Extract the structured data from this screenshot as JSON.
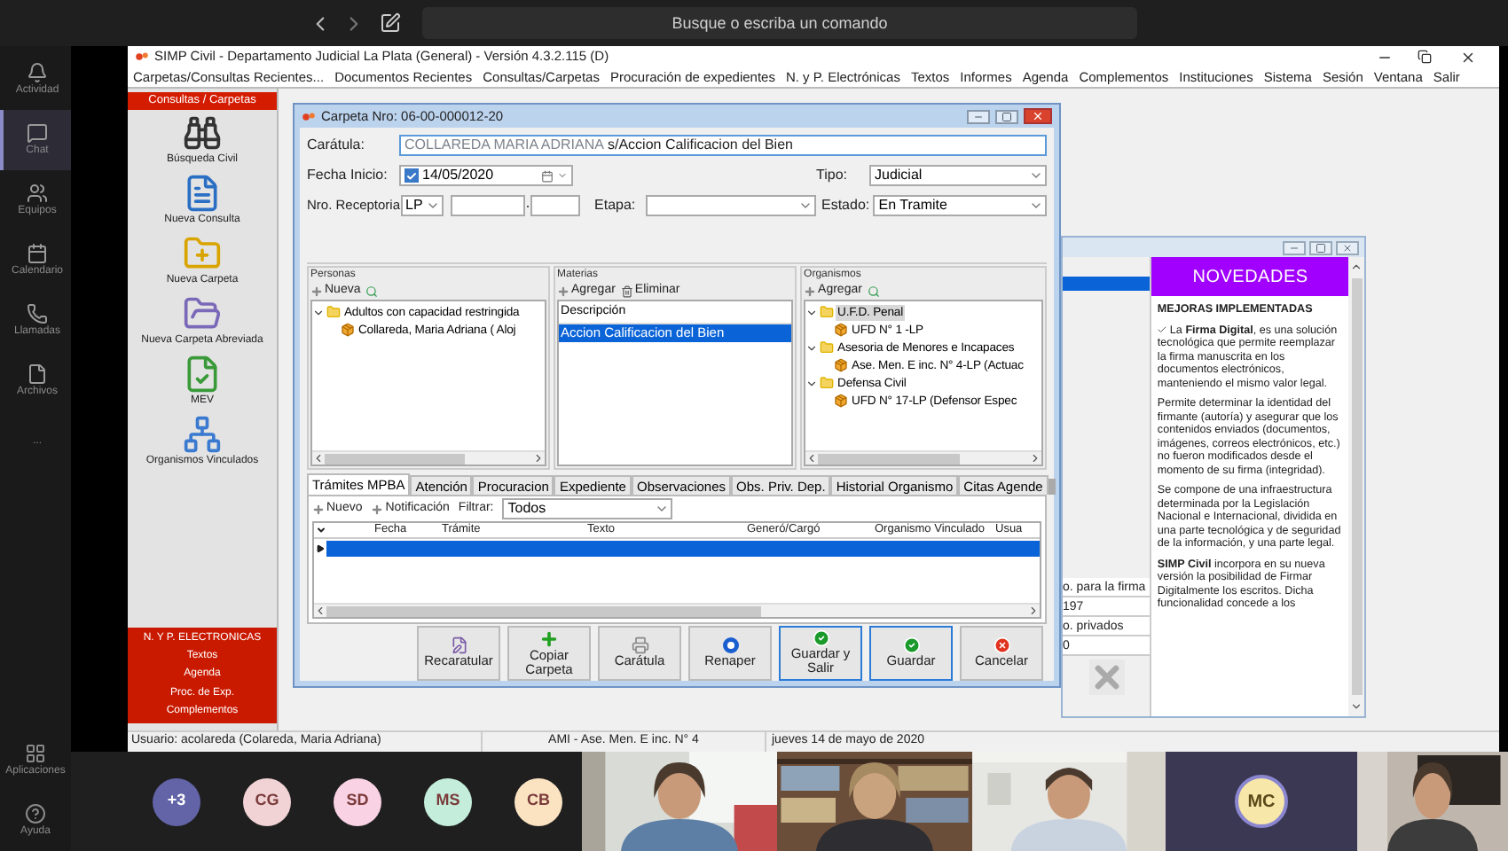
{
  "teams": {
    "search": {
      "placeholder": "Busque o escriba un comando"
    },
    "rail": [
      {
        "label": "Actividad",
        "selected": false
      },
      {
        "label": "Chat",
        "selected": true
      },
      {
        "label": "Equipos",
        "selected": false
      },
      {
        "label": "Calendario",
        "selected": false
      },
      {
        "label": "Llamadas",
        "selected": false
      },
      {
        "label": "Archivos",
        "selected": false
      },
      {
        "label": "...",
        "selected": false
      }
    ],
    "rail_bottom": [
      "Aplicaciones",
      "Ayuda"
    ]
  },
  "app": {
    "title": "SIMP Civil - Departamento Judicial La Plata (General) - Versión 4.3.2.115 (D)",
    "menu": [
      "Carpetas/Consultas Recientes...",
      "Documentos Recientes",
      "Consultas/Carpetas",
      "Procuración de expedientes",
      "N. y P. Electrónicas",
      "Textos",
      "Informes",
      "Agenda",
      "Complementos",
      "Instituciones",
      "Sistema",
      "Sesión",
      "Ventana",
      "Salir"
    ],
    "sidebar": {
      "header": "Consultas / Carpetas",
      "items": [
        "Búsqueda Civil",
        "Nueva Consulta",
        "Nueva Carpeta",
        "Nueva Carpeta Abreviada",
        "MEV",
        "Organismos Vinculados"
      ],
      "footer_title": "N. Y P. ELECTRONICAS",
      "footer_items": [
        "Textos",
        "Agenda",
        "Proc. de Exp.",
        "Complementos"
      ]
    },
    "status_bar": [
      "Usuario: acolareda  (Colareda, Maria Adriana)",
      "AMI - Ase. Men. E inc. N° 4",
      "jueves 14  de  mayo  de  2020"
    ]
  },
  "dialog": {
    "title": "Carpeta Nro: 06-00-000012-20",
    "caratula": {
      "label": "Carátula:",
      "name": "COLLAREDA MARIA ADRIANA",
      "value": "s/Accion Calificacion del Bien"
    },
    "fecha_inicio": {
      "label": "Fecha Inicio:",
      "checked": true,
      "value": "14/05/2020"
    },
    "tipo": {
      "label": "Tipo:",
      "value": "Judicial"
    },
    "receptoria": {
      "label": "Nro. Receptoria",
      "value": "LP"
    },
    "etapa": {
      "label": "Etapa:"
    },
    "estado": {
      "label": "Estado:",
      "value": "En Tramite"
    },
    "personas": {
      "title": "Personas",
      "actions": [
        "Nueva"
      ],
      "tree": [
        {
          "label": "Adultos con capacidad restringida",
          "expanded": true,
          "selected": false,
          "children": [
            {
              "label": "Collareda, Maria Adriana ( Aloj",
              "selected": false
            }
          ]
        }
      ]
    },
    "materias": {
      "title": "Materias",
      "actions": [
        "Agregar",
        "Eliminar"
      ],
      "column": "Descripción",
      "rows": [
        {
          "label": "Accion Calificacion del Bien",
          "selected": true
        }
      ]
    },
    "organismos": {
      "title": "Organismos",
      "actions": [
        "Agregar"
      ],
      "tree": [
        {
          "label": "U.F.D. Penal",
          "expanded": true,
          "selected": true,
          "children": [
            {
              "label": "UFD N° 1 -LP",
              "selected": false
            }
          ]
        },
        {
          "label": "Asesoria de Menores e Incapaces",
          "expanded": true,
          "selected": false,
          "children": [
            {
              "label": "Ase. Men. E inc. N° 4-LP  (Actuac",
              "selected": false
            }
          ]
        },
        {
          "label": "Defensa Civil",
          "expanded": true,
          "selected": false,
          "children": [
            {
              "label": "UFD N° 17-LP  (Defensor Espec",
              "selected": false
            }
          ]
        }
      ]
    },
    "tabs": [
      {
        "label": "Trámites MPBA",
        "selected": true
      },
      {
        "label": "Atención",
        "selected": false
      },
      {
        "label": "Procuracion",
        "selected": false
      },
      {
        "label": "Expediente",
        "selected": false
      },
      {
        "label": "Observaciones",
        "selected": false
      },
      {
        "label": "Obs. Priv. Dep.",
        "selected": false
      },
      {
        "label": "Historial Organismo",
        "selected": false
      },
      {
        "label": "Citas Agende",
        "selected": false
      }
    ],
    "toolbar": {
      "actions": [
        "Nuevo",
        "Notificación"
      ],
      "filter_label": "Filtrar:",
      "filter_value": "Todos"
    },
    "grid": {
      "columns": [
        "Fecha",
        "Trámite",
        "Texto",
        "Generó/Cargó",
        "Organismo Vinculado",
        "Usua"
      ],
      "rows": [
        {
          "selected": true
        }
      ]
    },
    "buttons": [
      {
        "label": "Recaratular",
        "focused": false
      },
      {
        "label": "Copiar Carpeta",
        "focused": false
      },
      {
        "label": "Carátula",
        "focused": false
      },
      {
        "label": "Renaper",
        "focused": false
      },
      {
        "label": "Guardar y Salir",
        "focused": true
      },
      {
        "label": "Guardar",
        "focused": true
      },
      {
        "label": "Cancelar",
        "focused": false
      }
    ]
  },
  "background_window": {
    "cells": [
      "o. para la firma",
      "197",
      "o. privados",
      "0"
    ],
    "novedades": {
      "title": "NOVEDADES",
      "heading": "MEJORAS IMPLEMENTADAS",
      "paragraphs": [
        "La **Firma Digital**, es una solución tecnológica que permite reemplazar la firma manuscrita en los documentos electrónicos, manteniendo el mismo valor legal.",
        "Permite determinar la identidad del firmante (autoría) y asegurar que los contenidos enviados (documentos, imágenes, correos electrónicos, etc.) no fueron modificados desde el momento de su firma (integridad).",
        "Se compone de una infraestructura determinada por la Legislación Nacional e Internacional, dividida en una parte tecnológica y de seguridad de la información, y una parte legal.",
        "**SIMP Civil** incorpora en su nueva versión la posibilidad de Firmar Digitalmente los escritos. Dicha funcionalidad concede a los"
      ]
    }
  },
  "participants": {
    "avatars": [
      {
        "initials": "+3",
        "color": "#6264a7"
      },
      {
        "initials": "CG",
        "color": "#f1d3d6"
      },
      {
        "initials": "SD",
        "color": "#f9d2e4"
      },
      {
        "initials": "MS",
        "color": "#c4eedb"
      },
      {
        "initials": "CB",
        "color": "#fbe3c2"
      }
    ],
    "tiles": [
      {
        "kind": "video"
      },
      {
        "kind": "video"
      },
      {
        "kind": "video"
      },
      {
        "kind": "avatar",
        "initials": "MC"
      },
      {
        "kind": "video"
      }
    ]
  }
}
